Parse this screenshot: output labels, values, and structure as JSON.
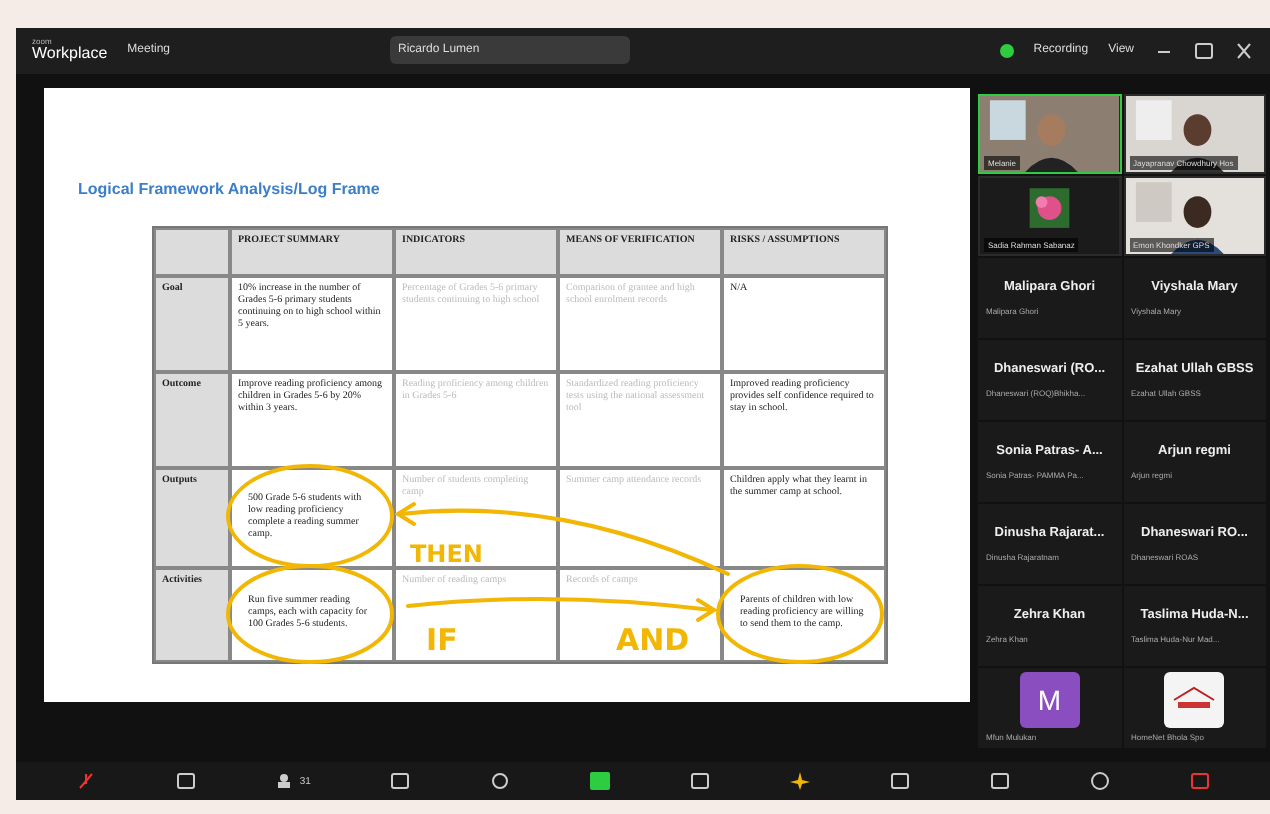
{
  "title_bar": {
    "app_small": "zoom",
    "app": "Workplace",
    "meeting": "Meeting",
    "share_label": "Ricardo Lumen",
    "recording": "Recording",
    "view": "View"
  },
  "slide": {
    "title": "Logical Framework Analysis/Log Frame",
    "columns": [
      "PROJECT SUMMARY",
      "INDICATORS",
      "MEANS OF VERIFICATION",
      "RISKS / ASSUMPTIONS"
    ],
    "rows": [
      {
        "label": "Goal",
        "cells": [
          "10% increase in the number of Grades 5-6 primary students continuing on to high school within 5 years.",
          "Percentage of Grades 5-6 primary students continuing to high school",
          "Comparison of grantee and high school enrolment records",
          "N/A"
        ]
      },
      {
        "label": "Outcome",
        "cells": [
          "Improve reading proficiency among children in Grades 5-6 by 20% within 3 years.",
          "Reading proficiency among children in Grades 5-6",
          "Standardized reading proficiency tests using the national assessment tool",
          "Improved reading proficiency provides self confidence required to stay in school."
        ]
      },
      {
        "label": "Outputs",
        "cells": [
          "500 Grade 5-6 students with low reading proficiency complete a reading summer camp.",
          "Number of students completing camp",
          "Summer camp attendance records",
          "Children apply what they learnt in the summer camp at school."
        ]
      },
      {
        "label": "Activities",
        "cells": [
          "Run five summer reading camps, each with capacity for 100 Grades 5-6 students.",
          "Number of reading camps",
          "Records of camps",
          "Parents of children with low reading proficiency are willing to send them to the camp."
        ]
      }
    ],
    "annotations": [
      "THEN",
      "IF",
      "AND"
    ]
  },
  "video_tiles": [
    {
      "name": "Melanie",
      "active": true
    },
    {
      "name": "Jayapranav Chowdhury Hos",
      "active": false
    },
    {
      "name": "Sadia Rahman Sabanaz",
      "active": false,
      "kind": "logo"
    },
    {
      "name": "Emon Khondker GPS",
      "active": false
    }
  ],
  "name_tiles": [
    {
      "display": "Malipara Ghori",
      "label": "Malipara Ghori"
    },
    {
      "display": "Viyshala Mary",
      "label": "Viyshala Mary"
    },
    {
      "display": "Dhaneswari (RO...",
      "label": "Dhaneswari (ROQ)Bhikha..."
    },
    {
      "display": "Ezahat Ullah GBSS",
      "label": "Ezahat Ullah GBSS"
    },
    {
      "display": "Sonia Patras- A...",
      "label": "Sonia Patras- PAMMA Pa..."
    },
    {
      "display": "Arjun regmi",
      "label": "Arjun regmi"
    },
    {
      "display": "Dinusha Rajarat...",
      "label": "Dinusha Rajaratnam"
    },
    {
      "display": "Dhaneswari RO...",
      "label": "Dhaneswari ROAS"
    },
    {
      "display": "Zehra Khan",
      "label": "Zehra Khan"
    },
    {
      "display": "Taslima Huda-N...",
      "label": "Taslima Huda-Nur Mad..."
    }
  ],
  "avatar_tiles": [
    {
      "kind": "letter",
      "letter": "M",
      "label": "Mfun Mulukan"
    },
    {
      "kind": "logo",
      "label": "HomeNet Bhola Spo"
    }
  ],
  "toolbar": {
    "participants": "31"
  }
}
